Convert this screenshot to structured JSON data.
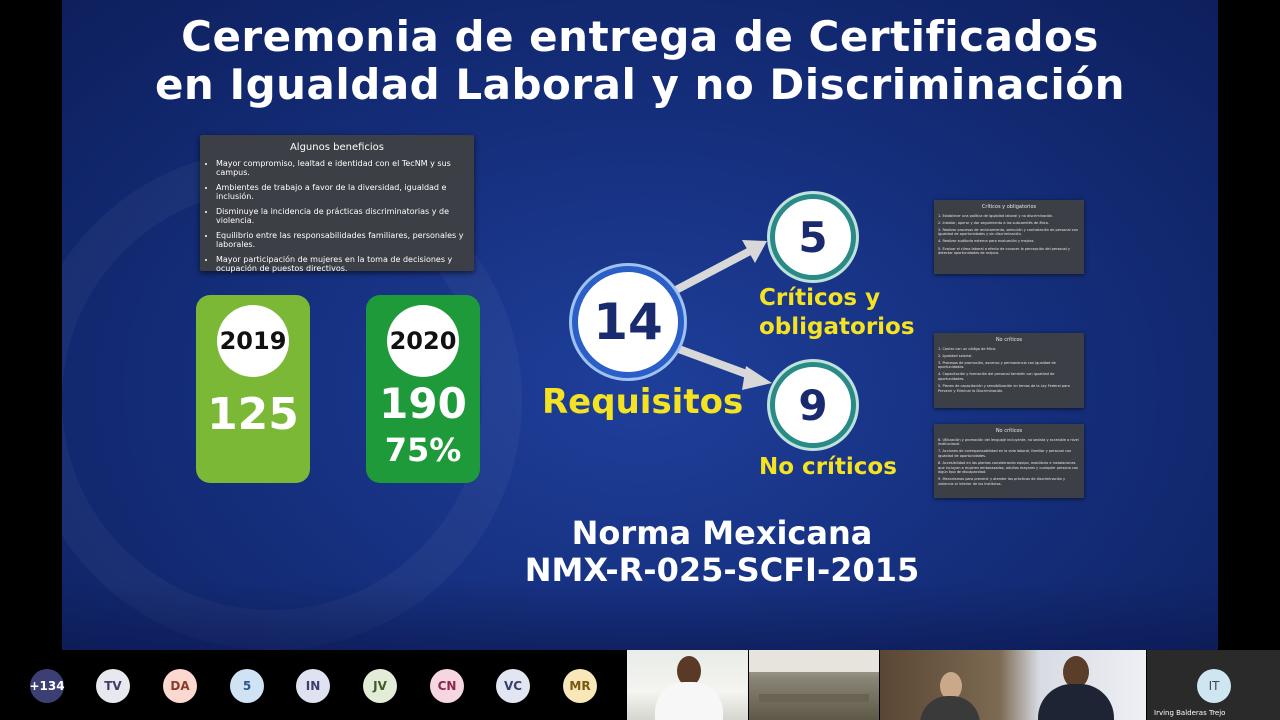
{
  "slide": {
    "title_line1": "Ceremonia de entrega de Certificados",
    "title_line2": "en Igualdad Laboral y no Discriminación",
    "benefits": {
      "heading": "Algunos beneficios",
      "items": [
        "Mayor compromiso, lealtad e identidad con el TecNM y sus campus.",
        "Ambientes de trabajo a favor de la diversidad, igualdad e inclusión.",
        "Disminuye la incidencia de prácticas discriminatorias y de violencia.",
        "Equilibrio entre las responsabilidades familiares, personales y laborales.",
        "Mayor participación de mujeres en la toma de decisiones y ocupación de puestos directivos."
      ]
    },
    "year1": {
      "year": "2019",
      "value": "125"
    },
    "year2": {
      "year": "2020",
      "value": "190",
      "percent": "75%"
    },
    "requirements": {
      "total": "14",
      "total_label": "Requisitos",
      "critical": "5",
      "critical_label_l1": "Críticos y",
      "critical_label_l2": "obligatorios",
      "noncritical": "9",
      "noncritical_label": "No críticos"
    },
    "norma_l1": "Norma Mexicana",
    "norma_l2": "NMX-R-025-SCFI-2015",
    "card1": {
      "heading": "Críticos y obligatorios",
      "items": [
        "1. Establecer una política de igualdad laboral y no discriminación.",
        "2. Instalar, operar y dar seguimiento a los subcomités de ética.",
        "3. Realizar procesos de reclutamiento, selección y contratación de personal con igualdad de oportunidades y sin discriminación.",
        "4. Realizar auditoría externa para evaluación y mejora.",
        "5. Evaluar el clima laboral a efecto de conocer la percepción del personal y detectar oportunidades de mejora."
      ]
    },
    "card2": {
      "heading": "No críticos",
      "items": [
        "1. Contar con un código de ética.",
        "2. Igualdad salarial.",
        "3. Procesos de promoción, ascenso y permanencia con igualdad de oportunidades.",
        "4. Capacitación y formación del personal también con igualdad de oportunidades.",
        "5. Planes de capacitación y sensibilización en temas de la Ley Federal para Prevenir y Eliminar la Discriminación."
      ]
    },
    "card3": {
      "heading": "No críticos",
      "items": [
        "6. Utilización y promoción del lenguaje incluyente, no sexista y accesible a nivel institucional.",
        "7. Acciones de corresponsabilidad en la vida laboral, familiar y personal con igualdad de oportunidades.",
        "8. Accesibilidad en las plantas considerando equipo, mobiliario e instalaciones que incluyan a mujeres embarazadas, adultos mayores y cualquier persona con algún tipo de discapacidad.",
        "9. Mecanismos para prevenir y atender las prácticas de discriminación y violencia al interior de los Institutos."
      ]
    }
  },
  "participants": {
    "more_count": "+134",
    "avatars": [
      {
        "initials": "TV",
        "bg": "#e8e8ef",
        "fg": "#3d3f6a"
      },
      {
        "initials": "DA",
        "bg": "#fbd9d0",
        "fg": "#8a3a2a"
      },
      {
        "initials": "5",
        "bg": "#cfe3f5",
        "fg": "#2a5a8a"
      },
      {
        "initials": "IN",
        "bg": "#dfe2f0",
        "fg": "#3d3f6a"
      },
      {
        "initials": "JV",
        "bg": "#e3ecd6",
        "fg": "#3e5a26"
      },
      {
        "initials": "CN",
        "bg": "#f6d6e0",
        "fg": "#8a2a4a"
      },
      {
        "initials": "VC",
        "bg": "#e2e6f2",
        "fg": "#3d3f6a"
      },
      {
        "initials": "MR",
        "bg": "#f8e7b8",
        "fg": "#7a5a10"
      }
    ],
    "more_bg": "#3b3f73",
    "tile4_initials": "IT",
    "tile4_name": "Irving Balderas Trejo"
  }
}
